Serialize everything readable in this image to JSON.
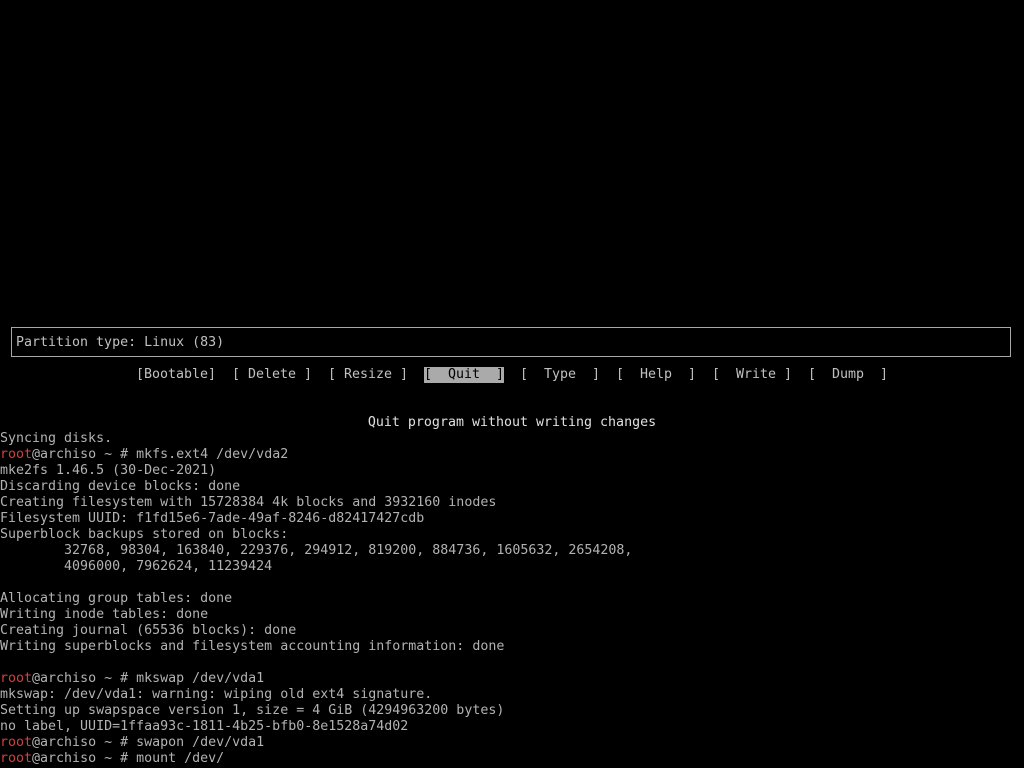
{
  "info_box": {
    "text": "Partition type: Linux (83)"
  },
  "menu": {
    "items": [
      {
        "label": "[Bootable]",
        "selected": false
      },
      {
        "label": "[ Delete ]",
        "selected": false
      },
      {
        "label": "[ Resize ]",
        "selected": false
      },
      {
        "label": "[  Quit  ]",
        "selected": true
      },
      {
        "label": "[  Type  ]",
        "selected": false
      },
      {
        "label": "[  Help  ]",
        "selected": false
      },
      {
        "label": "[  Write ]",
        "selected": false
      },
      {
        "label": "[  Dump  ]",
        "selected": false
      }
    ]
  },
  "hint": "Quit program without writing changes",
  "colors": {
    "prompt_user": "#d04040",
    "text": "#b2b2b2",
    "background": "#000000",
    "selected_bg": "#aaaaaa"
  },
  "console": {
    "lines": [
      {
        "type": "text",
        "text": "Syncing disks."
      },
      {
        "type": "prompt",
        "user": "root",
        "rest": "@archiso ~ # mkfs.ext4 /dev/vda2"
      },
      {
        "type": "text",
        "text": "mke2fs 1.46.5 (30-Dec-2021)"
      },
      {
        "type": "text",
        "text": "Discarding device blocks: done"
      },
      {
        "type": "text",
        "text": "Creating filesystem with 15728384 4k blocks and 3932160 inodes"
      },
      {
        "type": "text",
        "text": "Filesystem UUID: f1fd15e6-7ade-49af-8246-d82417427cdb"
      },
      {
        "type": "text",
        "text": "Superblock backups stored on blocks:"
      },
      {
        "type": "text",
        "text": "        32768, 98304, 163840, 229376, 294912, 819200, 884736, 1605632, 2654208,"
      },
      {
        "type": "text",
        "text": "        4096000, 7962624, 11239424"
      },
      {
        "type": "text",
        "text": ""
      },
      {
        "type": "text",
        "text": "Allocating group tables: done"
      },
      {
        "type": "text",
        "text": "Writing inode tables: done"
      },
      {
        "type": "text",
        "text": "Creating journal (65536 blocks): done"
      },
      {
        "type": "text",
        "text": "Writing superblocks and filesystem accounting information: done"
      },
      {
        "type": "text",
        "text": ""
      },
      {
        "type": "prompt",
        "user": "root",
        "rest": "@archiso ~ # mkswap /dev/vda1"
      },
      {
        "type": "text",
        "text": "mkswap: /dev/vda1: warning: wiping old ext4 signature."
      },
      {
        "type": "text",
        "text": "Setting up swapspace version 1, size = 4 GiB (4294963200 bytes)"
      },
      {
        "type": "text",
        "text": "no label, UUID=1ffaa93c-1811-4b25-bfb0-8e1528a74d02"
      },
      {
        "type": "prompt",
        "user": "root",
        "rest": "@archiso ~ # swapon /dev/vda1"
      },
      {
        "type": "prompt",
        "user": "root",
        "rest": "@archiso ~ # mount /dev/"
      }
    ]
  }
}
